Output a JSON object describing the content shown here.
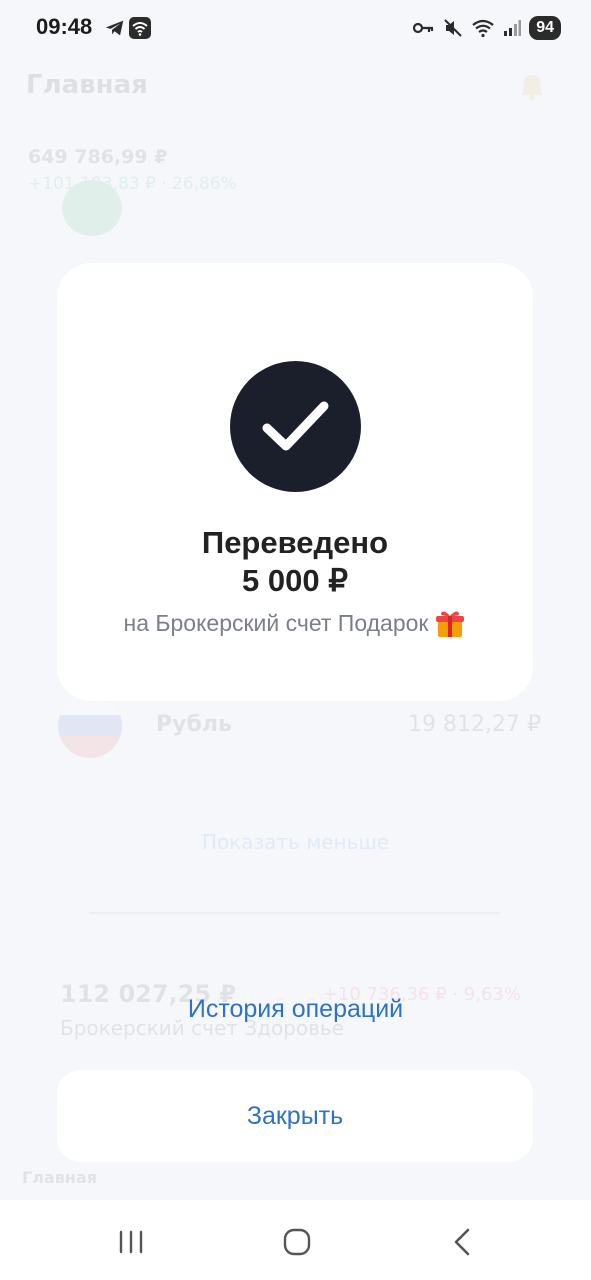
{
  "status_bar": {
    "time": "09:48",
    "battery": "94",
    "icons": [
      "telegram-icon",
      "wifi-box-icon",
      "key-icon",
      "mute-icon",
      "wifi-icon",
      "signal-icon"
    ]
  },
  "background": {
    "title": "Главная",
    "total": "649 786,99 ₽",
    "change": "+101 193,83 ₽ · 26,86%",
    "ruble_label": "Рубль",
    "ruble_value": "19 812,27 ₽",
    "show_less": "Показать меньше",
    "account_value": "112 027,25 ₽",
    "account_change": "+10 736,36 ₽ · 9,63%",
    "account_name": "Брокерский счет Здоровье",
    "tab_main": "Главная"
  },
  "success": {
    "title": "Переведено",
    "amount": "5 000 ₽",
    "destination": "на Брокерский счет Подарок",
    "destination_icon": "gift-icon"
  },
  "actions": {
    "history_label": "История операций",
    "close_label": "Закрыть"
  },
  "colors": {
    "accent": "#2e72c8",
    "check_circle": "#1a1f2b",
    "card_bg": "#ffffff",
    "page_bg": "#f5f7fb"
  }
}
